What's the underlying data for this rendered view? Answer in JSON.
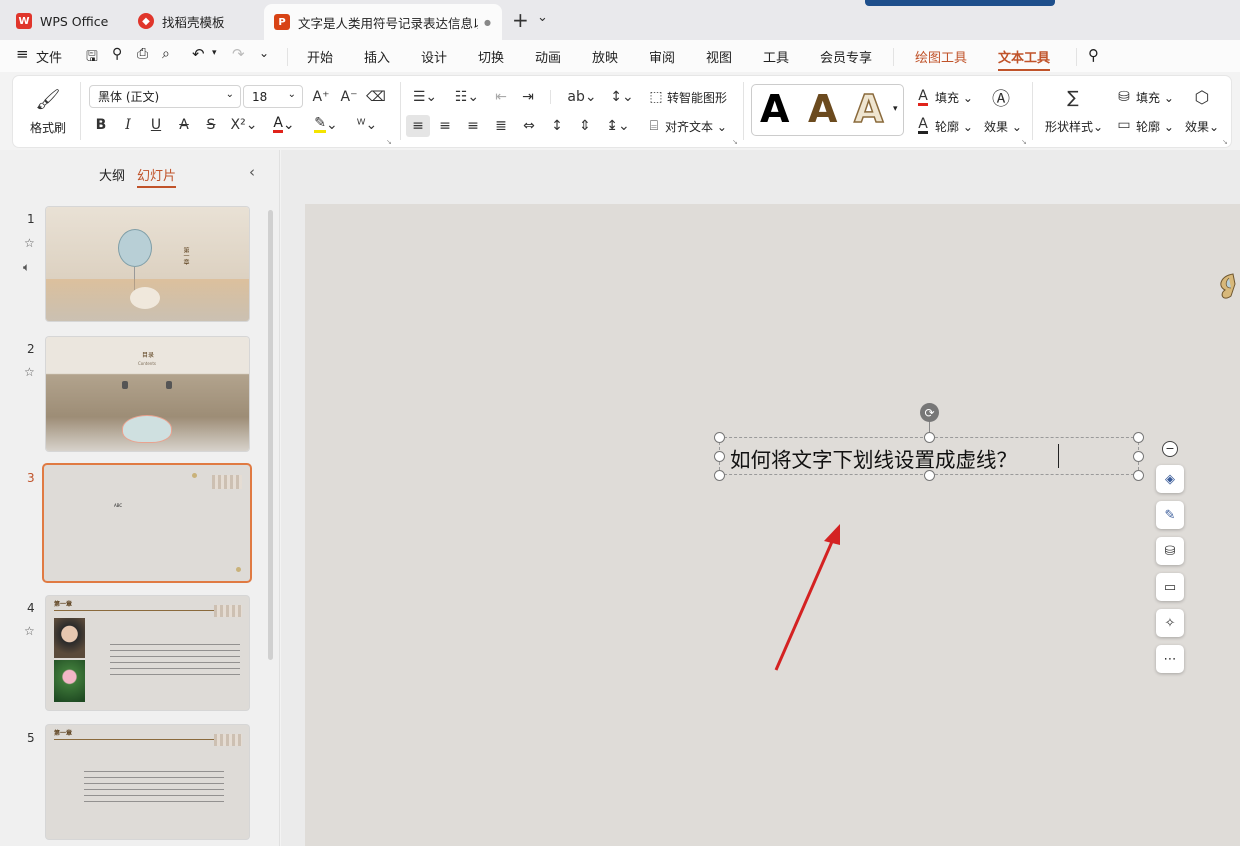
{
  "tabs": {
    "wps": "WPS Office",
    "template": "找稻壳模板",
    "doc": "文字是人类用符号记录表达信息以",
    "doc_dot": "●",
    "new": "+",
    "more": "⌄"
  },
  "menu": {
    "hamburger": "≡",
    "file": "文件",
    "items": [
      "开始",
      "插入",
      "设计",
      "切换",
      "动画",
      "放映",
      "审阅",
      "视图",
      "工具",
      "会员专享"
    ],
    "draw_tools": "绘图工具",
    "text_tools": "文本工具"
  },
  "ribbon": {
    "format_painter": "格式刷",
    "font_name": "黑体 (正文)",
    "font_size": "18",
    "smart_graphic": "转智能图形",
    "align_text": "对齐文本",
    "fill": "填充",
    "outline": "轮廓",
    "effect": "效果",
    "shape_style": "形状样式",
    "fill2": "填充",
    "outline2": "轮廓",
    "effect2": "效果",
    "style_letter": "A"
  },
  "panel": {
    "outline_tab": "大纲",
    "slides_tab": "幻灯片",
    "slides": [
      {
        "num": "1",
        "title_v": "第一章"
      },
      {
        "num": "2",
        "title": "目录",
        "sub": "Contents"
      },
      {
        "num": "3",
        "text": "ABC"
      },
      {
        "num": "4",
        "title": "第一章"
      },
      {
        "num": "5",
        "title": "第一章"
      }
    ]
  },
  "slide": {
    "textbox": "如何将文字下划线设置成虚线？"
  },
  "colors": {
    "accent": "#c0532a",
    "wps_red": "#e0352b",
    "arrow_red": "#d42222"
  }
}
